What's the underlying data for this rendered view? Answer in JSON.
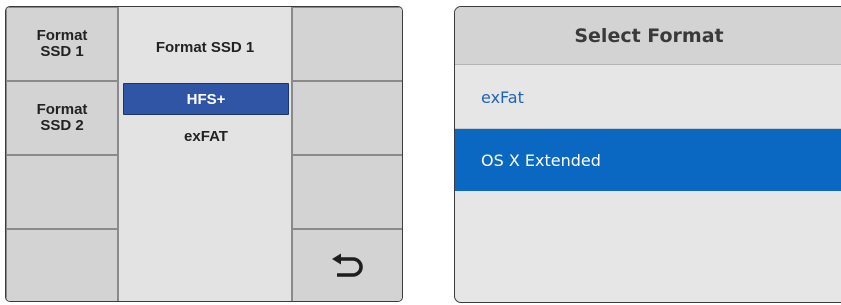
{
  "left_panel": {
    "buttons": {
      "r1_left": "Format\nSSD 1",
      "r2_left": "Format\nSSD 2",
      "r1_right": "",
      "r2_right": "",
      "r3_left": "",
      "r3_right": "",
      "r4_left": ""
    },
    "menu": {
      "title": "Format SSD 1",
      "items": [
        {
          "label": "HFS+",
          "selected": true
        },
        {
          "label": "exFAT",
          "selected": false
        }
      ]
    },
    "back_icon": "back-arrow-icon"
  },
  "right_panel": {
    "title": "Select Format",
    "options": [
      {
        "label": "exFat",
        "selected": false
      },
      {
        "label": "OS X Extended",
        "selected": true
      }
    ]
  },
  "colors": {
    "button_gray": "#d3d3d3",
    "menu_bg": "#e3e3e3",
    "menu_selected": "#2f55a4",
    "dialog_bg": "#e6e6e6",
    "option_link": "#1e64b4",
    "option_selected": "#0a68c3"
  }
}
